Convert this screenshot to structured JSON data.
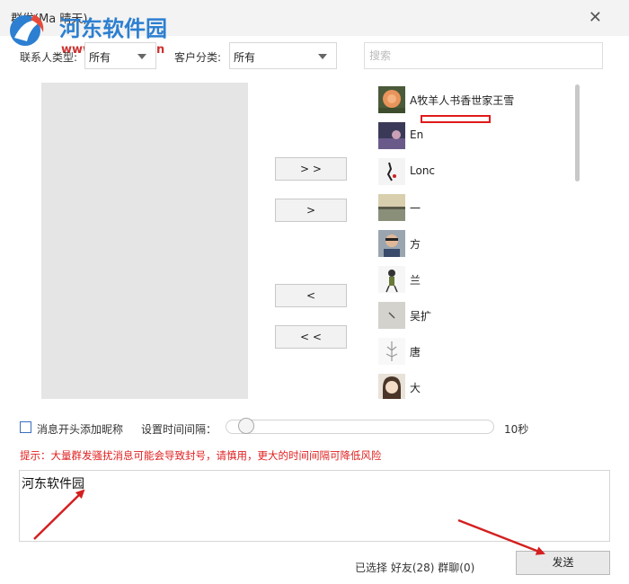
{
  "window": {
    "title": "群发(Ma   晴天)",
    "close": "✕"
  },
  "watermark": {
    "name": "河东软件园",
    "url": "www.pc0359.cn"
  },
  "filters": {
    "contact_type_label": "联系人类型:",
    "contact_type_value": "所有",
    "customer_label": "客户分类:",
    "customer_value": "所有",
    "search_placeholder": "搜索"
  },
  "move_buttons": {
    "add_all": "> >",
    "add_one": ">",
    "remove_one": "<",
    "remove_all": "< <"
  },
  "friends": [
    {
      "name": "A牧羊人书香世家王雪"
    },
    {
      "name": "En"
    },
    {
      "name": "Lonc"
    },
    {
      "name": "一"
    },
    {
      "name": "方"
    },
    {
      "name": "兰"
    },
    {
      "name": "吴扩"
    },
    {
      "name": "唐"
    },
    {
      "name": "大"
    }
  ],
  "options": {
    "prepend_nickname_label": "消息开头添加昵称",
    "interval_label": "设置时间间隔：",
    "interval_value": "10秒",
    "interval_fraction": 0.05
  },
  "tip": "提示：大量群发骚扰消息可能会导致封号，请慎用，更大的时间间隔可降低风险",
  "message": {
    "text": "河东软件园"
  },
  "footer": {
    "status": "已选择 好友(28) 群聊(0)",
    "send_label": "发送"
  },
  "colors": {
    "warning": "#e02020",
    "accent": "#2c7fd1",
    "annotation_arrow": "#d42020"
  },
  "icons": {
    "close": "close-icon",
    "dropdown": "chevron-down-icon"
  }
}
